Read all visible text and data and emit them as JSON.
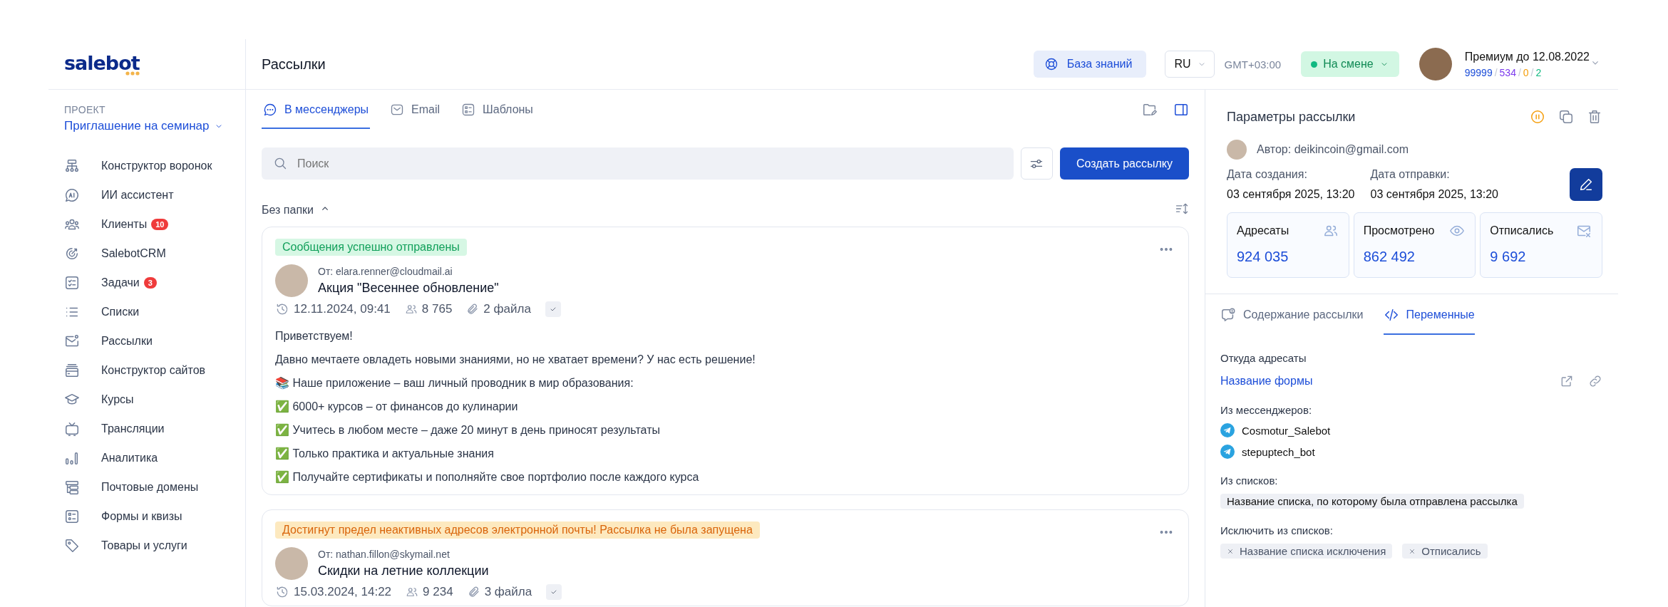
{
  "sidebar": {
    "logo": "salebot",
    "project_label": "ПРОЕКТ",
    "project_name": "Приглашение на семинар",
    "items": [
      {
        "label": "Конструктор воронок"
      },
      {
        "label": "ИИ ассистент"
      },
      {
        "label": "Клиенты",
        "badge": "10"
      },
      {
        "label": "SalebotCRM"
      },
      {
        "label": "Задачи",
        "badge": "3"
      },
      {
        "label": "Списки"
      },
      {
        "label": "Рассылки"
      },
      {
        "label": "Конструктор сайтов"
      },
      {
        "label": "Курсы"
      },
      {
        "label": "Трансляции"
      },
      {
        "label": "Аналитика"
      },
      {
        "label": "Почтовые домены"
      },
      {
        "label": "Формы и квизы"
      },
      {
        "label": "Товары и услуги"
      }
    ]
  },
  "header": {
    "title": "Рассылки",
    "kb_button": "База знаний",
    "language": "RU",
    "timezone": "GMT+03:00",
    "status": "На смене",
    "plan": "Премиум до 12.08.2022",
    "separator": "/",
    "counters": [
      {
        "value": "99999",
        "color": "#1d4ed8"
      },
      {
        "value": "534",
        "color": "#7c3aed"
      },
      {
        "value": "0",
        "color": "#f59e0b"
      },
      {
        "value": "2",
        "color": "#10b981"
      }
    ]
  },
  "tabs": [
    {
      "label": "В мессенджеры",
      "selected": true
    },
    {
      "label": "Email",
      "selected": false
    },
    {
      "label": "Шаблоны",
      "selected": false
    }
  ],
  "search": {
    "placeholder": "Поиск"
  },
  "create_button": "Создать рассылку",
  "folder": {
    "label": "Без папки",
    "expanded": true
  },
  "campaigns": [
    {
      "status": {
        "text": "Сообщения успешно отправлены",
        "kind": "success"
      },
      "from": "От: elara.renner@cloudmail.ai",
      "title": "Акция \"Весеннее обновление\"",
      "date": "12.11.2024, 09:41",
      "recipients": "8 765",
      "files": "2 файла",
      "body": [
        "Приветствуем!",
        "Давно мечтаете овладеть новыми знаниями, но не хватает времени? У нас есть решение!",
        "📚 Наше приложение – ваш личный проводник в мир образования:",
        "✅ 6000+ курсов – от финансов до кулинарии",
        "✅ Учитесь в любом месте – даже 20 минут в день приносят результаты",
        "✅ Только практика и актуальные знания",
        "✅ Получайте сертификаты и пополняйте свое портфолио после каждого курса"
      ]
    },
    {
      "status": {
        "text": "Достигнут предел неактивных адресов электронной почты! Рассылка не была запущена",
        "kind": "warning"
      },
      "from": "От: nathan.fillon@skymail.net",
      "title": "Скидки на летние коллекции",
      "date": "15.03.2024, 14:22",
      "recipients": "9 234",
      "files": "3 файла"
    }
  ],
  "details": {
    "title": "Параметры рассылки",
    "author": "Автор: deikincoin@gmail.com",
    "created_label": "Дата создания:",
    "created": "03 сентября 2025, 13:20",
    "sent_label": "Дата отправки:",
    "sent": "03 сентября 2025, 13:20",
    "stats": [
      {
        "label": "Адресаты",
        "value": "924 035"
      },
      {
        "label": "Просмотрено",
        "value": "862 492"
      },
      {
        "label": "Отписались",
        "value": "9 692"
      }
    ],
    "tabs": [
      {
        "label": "Содержание рассылки",
        "selected": false
      },
      {
        "label": "Переменные",
        "selected": true
      }
    ],
    "source_label": "Откуда адресаты",
    "source_link": "Название формы",
    "messengers_label": "Из мессенджеров:",
    "messengers": [
      "Cosmotur_Salebot",
      "stepuptech_bot"
    ],
    "lists_label": "Из списков:",
    "lists": [
      "Название списка, по которому была отправлена рассылка"
    ],
    "exclude_label": "Исключить из списков:",
    "exclude": [
      "Название списка исключения",
      "Отписались"
    ]
  }
}
